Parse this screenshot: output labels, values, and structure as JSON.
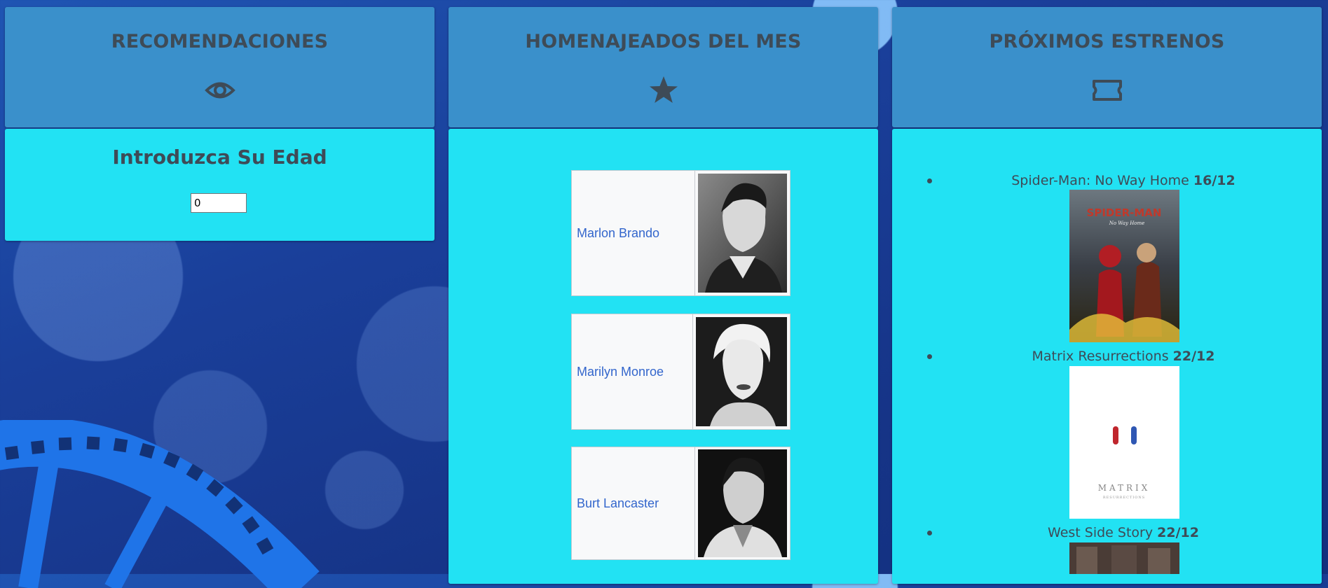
{
  "columns": {
    "recommendations": {
      "title": "RECOMENDACIONES",
      "icon": "eye-icon"
    },
    "tributes": {
      "title": "HOMENAJEADOS DEL MES",
      "icon": "star-icon"
    },
    "premieres": {
      "title": "PRÓXIMOS ESTRENOS",
      "icon": "ticket-icon"
    }
  },
  "age_form": {
    "title": "Introduzca Su Edad",
    "value": "0"
  },
  "tributes": [
    {
      "name": "Marlon Brando"
    },
    {
      "name": "Marilyn Monroe"
    },
    {
      "name": "Burt Lancaster"
    }
  ],
  "premieres": [
    {
      "title": "Spider-Man: No Way Home",
      "date": "16/12",
      "poster_text": "SPIDER-MAN",
      "poster_subtext": "No Way Home"
    },
    {
      "title": "Matrix Resurrections",
      "date": "22/12",
      "poster_text": "MATRIX",
      "poster_subtext": "RESURRECTIONS"
    },
    {
      "title": "West Side Story",
      "date": "22/12"
    }
  ],
  "colors": {
    "header_bg": "#3a90cb",
    "body_bg": "#22e2f3",
    "text": "#3e4b57",
    "link": "#3366cc"
  }
}
